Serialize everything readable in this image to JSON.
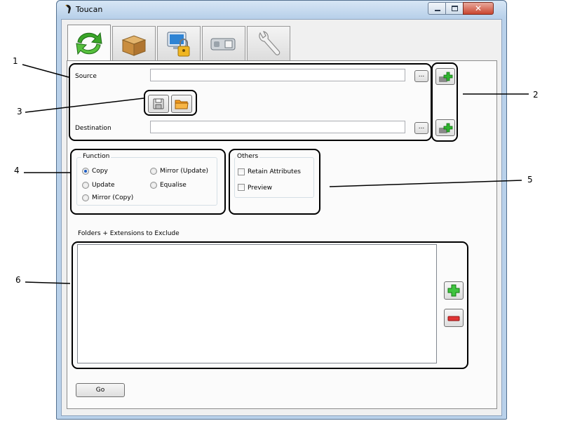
{
  "window": {
    "title": "Toucan"
  },
  "tabs": [
    {
      "name": "sync",
      "icon": "sync-arrows-icon"
    },
    {
      "name": "backup",
      "icon": "box-icon"
    },
    {
      "name": "secure",
      "icon": "computer-lock-icon"
    },
    {
      "name": "usb",
      "icon": "usb-drive-icon"
    },
    {
      "name": "settings",
      "icon": "wrench-icon"
    }
  ],
  "sync": {
    "source_label": "Source",
    "source_value": "",
    "destination_label": "Destination",
    "destination_value": "",
    "browse_label": "...",
    "function_group": {
      "title": "Function",
      "options": [
        "Copy",
        "Mirror (Update)",
        "Update",
        "Equalise",
        "Mirror (Copy)"
      ],
      "selected": "Copy"
    },
    "others_group": {
      "title": "Others",
      "options": [
        "Retain Attributes",
        "Preview"
      ]
    },
    "exclude_label": "Folders + Extensions to Exclude",
    "go_label": "Go"
  },
  "callouts": [
    "1",
    "2",
    "3",
    "4",
    "5",
    "6"
  ]
}
